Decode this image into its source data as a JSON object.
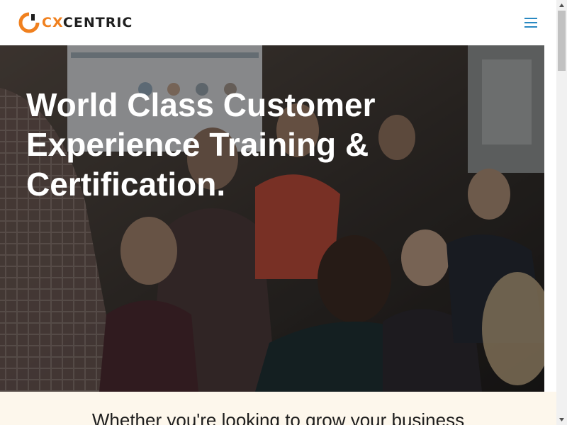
{
  "header": {
    "logo": {
      "cx": "CX",
      "centric": "CENTRIC"
    },
    "menu_icon": "hamburger-menu-icon"
  },
  "hero": {
    "title": "World Class Customer Experience Training & Certification.",
    "background": "photo of a seated training audience"
  },
  "intro": {
    "text": "Whether you're looking to grow your business"
  },
  "colors": {
    "brand_orange": "#f0801e",
    "menu_blue": "#2a89c2",
    "intro_bg": "#fdf7ec"
  }
}
